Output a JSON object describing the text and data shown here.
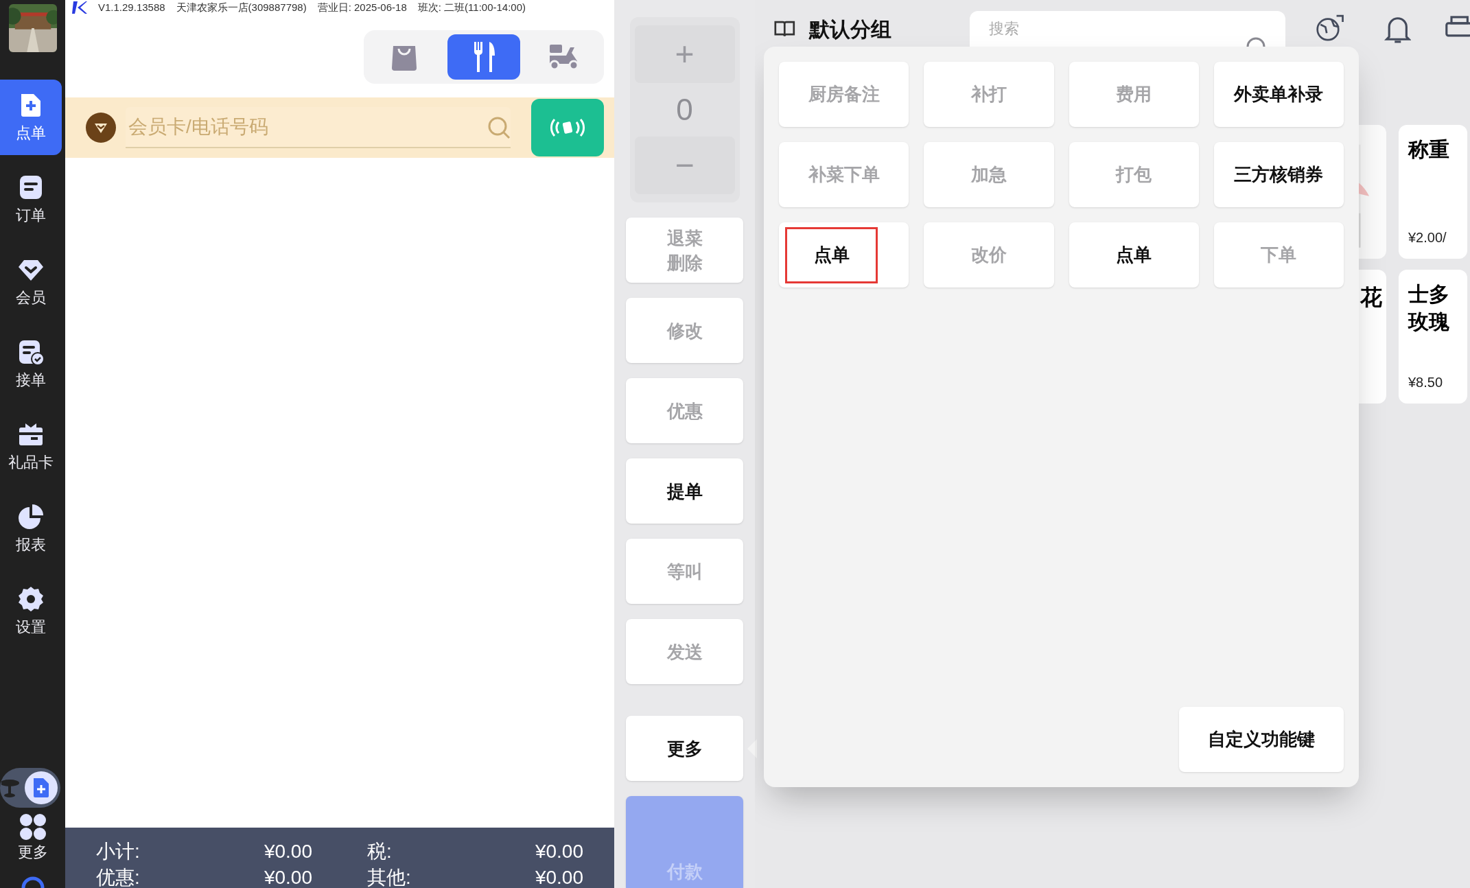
{
  "status_line": [
    "V1.1.29.13588",
    "天津农家乐一店(309887798)",
    "营业日: 2025-06-18",
    "班次: 二班(11:00-14:00)"
  ],
  "sidebar": {
    "items": [
      {
        "label": "点单",
        "selected": true
      },
      {
        "label": "订单",
        "selected": false
      },
      {
        "label": "会员",
        "selected": false
      },
      {
        "label": "接单",
        "selected": false
      },
      {
        "label": "礼品卡",
        "selected": false
      },
      {
        "label": "报表",
        "selected": false
      },
      {
        "label": "设置",
        "selected": false
      }
    ],
    "more": "更多"
  },
  "order_types": [
    {
      "selected": false
    },
    {
      "selected": true
    },
    {
      "selected": false
    }
  ],
  "member_search": {
    "placeholder": "会员卡/电话号码"
  },
  "summary": [
    {
      "label": "小计:",
      "value": "¥0.00"
    },
    {
      "label": "税:",
      "value": "¥0.00"
    },
    {
      "label": "优惠:",
      "value": "¥0.00"
    },
    {
      "label": "其他:",
      "value": "¥0.00"
    }
  ],
  "quantity": {
    "plus": "+",
    "value": "0",
    "minus": "−"
  },
  "mode_toggle": [
    {
      "selected": false
    },
    {
      "selected": true
    }
  ],
  "actions": [
    {
      "label": "退菜删除",
      "enabled": false
    },
    {
      "label": "修改",
      "enabled": false
    },
    {
      "label": "优惠",
      "enabled": false
    },
    {
      "label": "提单",
      "enabled": true
    },
    {
      "label": "等叫",
      "enabled": false
    },
    {
      "label": "发送",
      "enabled": false
    },
    {
      "label": "更多",
      "enabled": true,
      "expanded": true
    },
    {
      "label": "付款",
      "enabled": false,
      "kind": "pay"
    }
  ],
  "menu_header": {
    "group": "默认分组",
    "search_placeholder": "搜索"
  },
  "products": [
    {
      "name": "称重",
      "price": "¥2.00/"
    },
    {
      "name": "士多玫瑰",
      "price": "¥8.50"
    }
  ],
  "partial_products": [
    {
      "kind": "picture"
    },
    {
      "name": "花"
    }
  ],
  "more_popup": {
    "buttons": [
      {
        "label": "厨房备注",
        "enabled": false,
        "highlighted": false
      },
      {
        "label": "补打",
        "enabled": false,
        "highlighted": false
      },
      {
        "label": "费用",
        "enabled": false,
        "highlighted": false
      },
      {
        "label": "外卖单补录",
        "enabled": true,
        "highlighted": false
      },
      {
        "label": "补菜下单",
        "enabled": false,
        "highlighted": false
      },
      {
        "label": "加急",
        "enabled": false,
        "highlighted": false
      },
      {
        "label": "打包",
        "enabled": false,
        "highlighted": false
      },
      {
        "label": "三方核销券",
        "enabled": true,
        "highlighted": false
      },
      {
        "label": "点单",
        "enabled": true,
        "highlighted": true
      },
      {
        "label": "改价",
        "enabled": false,
        "highlighted": false
      },
      {
        "label": "点单",
        "enabled": true,
        "highlighted": false
      },
      {
        "label": "下单",
        "enabled": false,
        "highlighted": false
      }
    ],
    "custom": "自定义功能键"
  }
}
